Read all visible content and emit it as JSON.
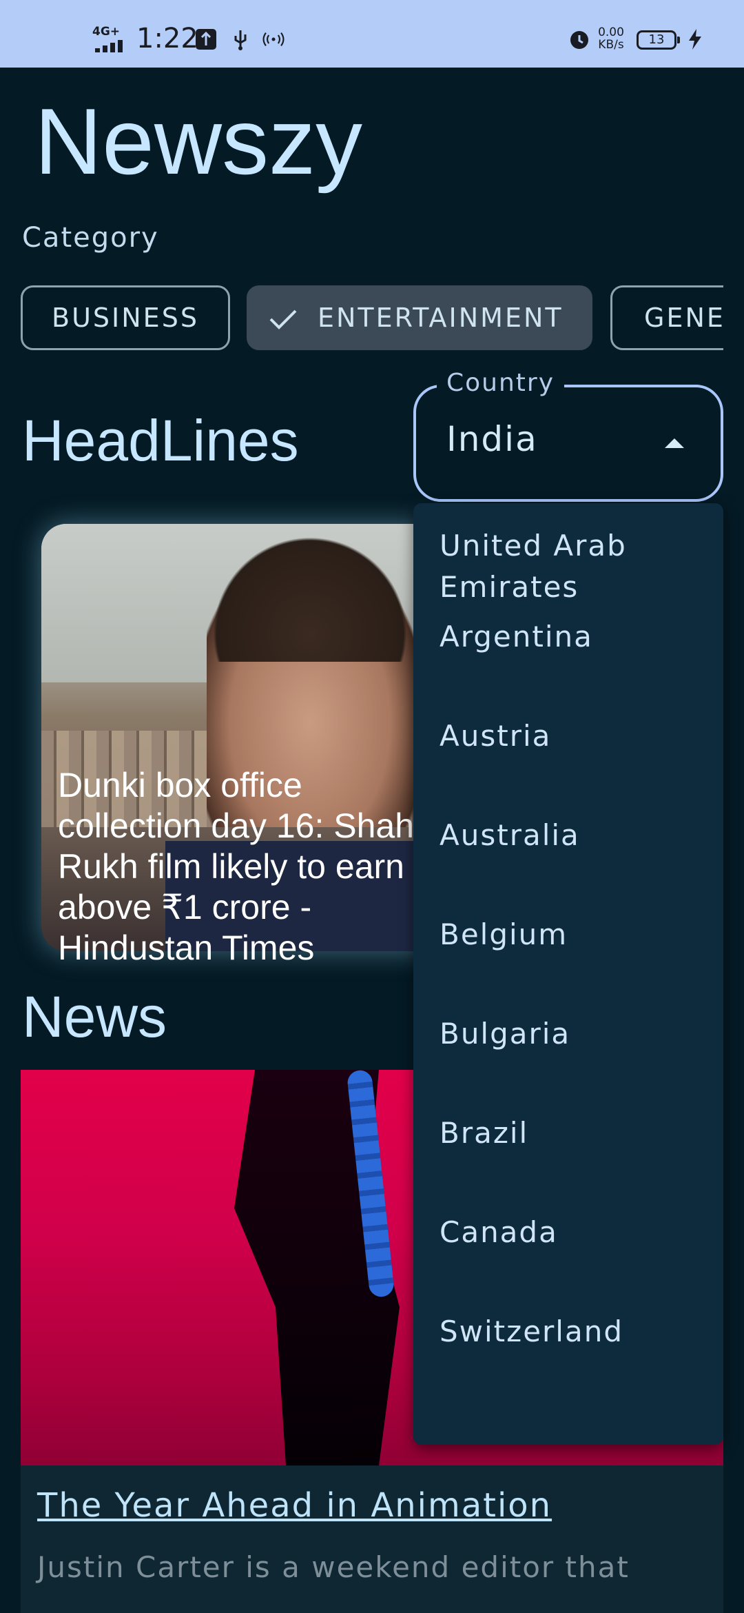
{
  "status_bar": {
    "network": "4G+",
    "time": "1:22",
    "speed_value": "0.00",
    "speed_unit": "KB/s",
    "battery": "13",
    "icons": [
      "usb-debug-icon",
      "usb-icon",
      "hotspot-icon",
      "alarm-icon",
      "charging-icon"
    ]
  },
  "app": {
    "title": "Newszy",
    "category_label": "Category",
    "chips": [
      {
        "label": "BUSINESS",
        "selected": false
      },
      {
        "label": "ENTERTAINMENT",
        "selected": true
      },
      {
        "label": "GENE",
        "selected": false
      }
    ]
  },
  "headlines": {
    "title": "HeadLines",
    "card": {
      "caption": "Dunki box office collection day 16: Shah Rukh film likely to earn above ₹1 crore - Hindustan Times"
    }
  },
  "country_select": {
    "label": "Country",
    "value": "India",
    "options": [
      "United Arab Emirates",
      "Argentina",
      "Austria",
      "Australia",
      "Belgium",
      "Bulgaria",
      "Brazil",
      "Canada",
      "Switzerland"
    ]
  },
  "news": {
    "title": "News",
    "card": {
      "headline": "The Year Ahead in Animation",
      "description": "Justin Carter is a weekend editor that"
    }
  },
  "colors": {
    "background": "#041a24",
    "status_bar": "#b3cdf8",
    "accent_text": "#c6e7ff",
    "menu_background": "#0e2b3e",
    "field_border": "#a9c7fb"
  }
}
